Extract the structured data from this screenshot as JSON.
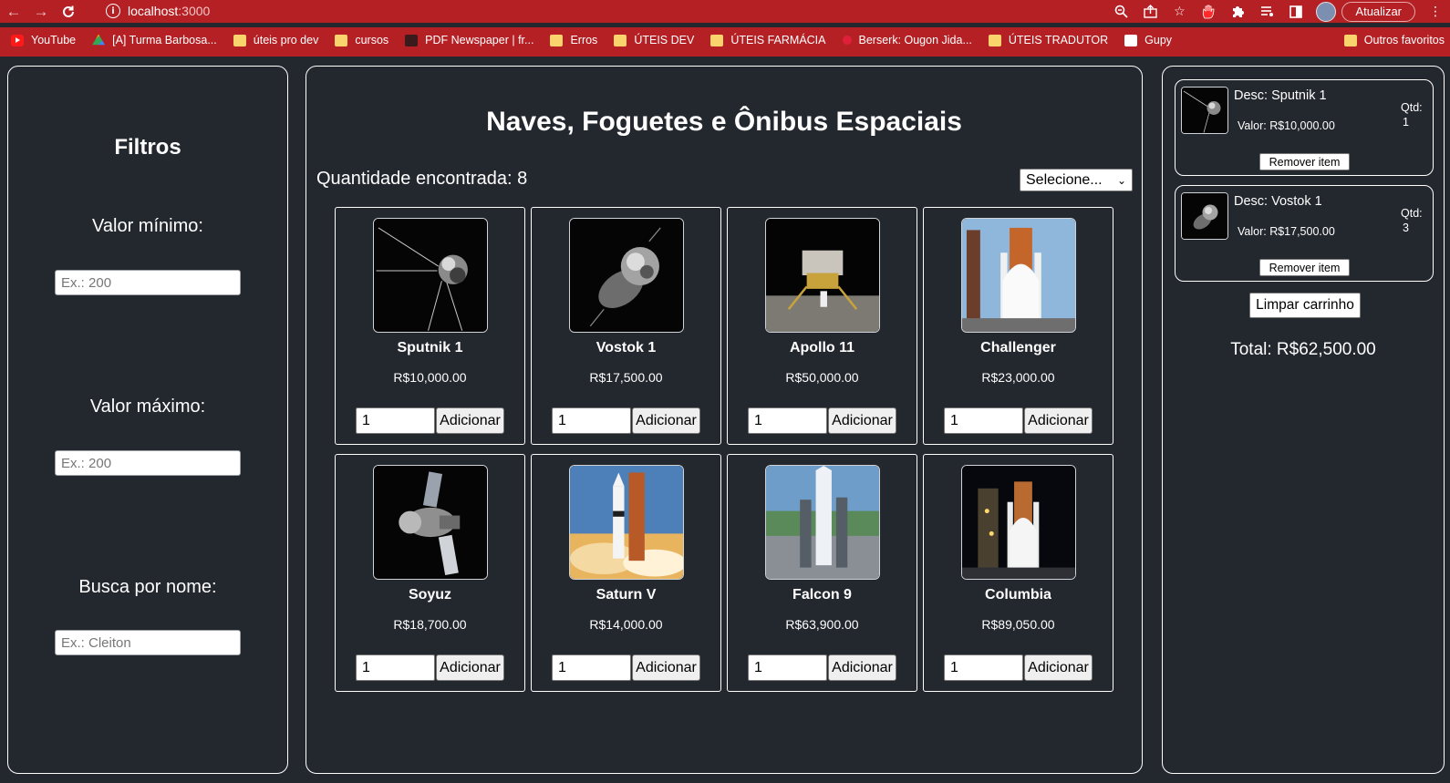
{
  "browser": {
    "url_host": "localhost",
    "url_port": ":3000",
    "update_label": "Atualizar",
    "bookmarks": [
      {
        "label": "YouTube",
        "icon": "youtube-icon"
      },
      {
        "label": "[A] Turma Barbosa...",
        "icon": "drive-icon"
      },
      {
        "label": "úteis pro dev",
        "icon": "folder-icon"
      },
      {
        "label": "cursos",
        "icon": "folder-icon"
      },
      {
        "label": "PDF Newspaper | fr...",
        "icon": "pdf-newspaper-icon"
      },
      {
        "label": "Erros",
        "icon": "folder-icon"
      },
      {
        "label": "ÚTEIS DEV",
        "icon": "folder-icon"
      },
      {
        "label": "ÚTEIS FARMÁCIA",
        "icon": "folder-icon"
      },
      {
        "label": "Berserk: Ougon Jida...",
        "icon": "berserk-icon"
      },
      {
        "label": "ÚTEIS TRADUTOR",
        "icon": "folder-icon"
      },
      {
        "label": "Gupy",
        "icon": "gupy-icon"
      }
    ],
    "other_bookmarks": "Outros favoritos"
  },
  "filters": {
    "title": "Filtros",
    "min_label": "Valor mínimo:",
    "min_placeholder": "Ex.: 200",
    "max_label": "Valor máximo:",
    "max_placeholder": "Ex.: 200",
    "search_label": "Busca por nome:",
    "search_placeholder": "Ex.: Cleiton"
  },
  "main": {
    "title": "Naves, Foguetes e Ônibus Espaciais",
    "quantity_label": "Quantidade encontrada: 8",
    "sort_selected": "Selecione...",
    "add_label": "Adicionar",
    "products": [
      {
        "name": "Sputnik 1",
        "price": "R$10,000.00",
        "qty": "1",
        "image": "sputnik"
      },
      {
        "name": "Vostok 1",
        "price": "R$17,500.00",
        "qty": "1",
        "image": "vostok"
      },
      {
        "name": "Apollo 11",
        "price": "R$50,000.00",
        "qty": "1",
        "image": "apollo"
      },
      {
        "name": "Challenger",
        "price": "R$23,000.00",
        "qty": "1",
        "image": "shuttle-day"
      },
      {
        "name": "Soyuz",
        "price": "R$18,700.00",
        "qty": "1",
        "image": "soyuz"
      },
      {
        "name": "Saturn V",
        "price": "R$14,000.00",
        "qty": "1",
        "image": "saturn"
      },
      {
        "name": "Falcon 9",
        "price": "R$63,900.00",
        "qty": "1",
        "image": "falcon"
      },
      {
        "name": "Columbia",
        "price": "R$89,050.00",
        "qty": "1",
        "image": "shuttle-night"
      }
    ]
  },
  "cart": {
    "items": [
      {
        "desc": "Desc: Sputnik 1",
        "value": "Valor: R$10,000.00",
        "qtd_label": "Qtd:",
        "qtd": "1",
        "remove_label": "Remover item",
        "image": "sputnik"
      },
      {
        "desc": "Desc: Vostok 1",
        "value": "Valor: R$17,500.00",
        "qtd_label": "Qtd:",
        "qtd": "3",
        "remove_label": "Remover item",
        "image": "vostok"
      }
    ],
    "clear_label": "Limpar carrinho",
    "total": "Total: R$62,500.00"
  }
}
